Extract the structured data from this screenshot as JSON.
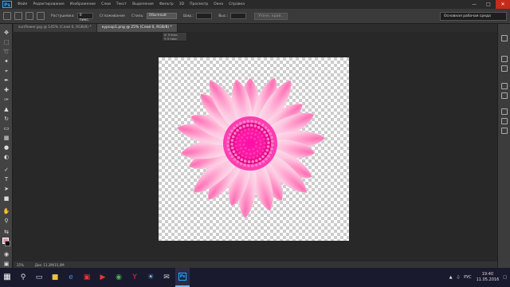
{
  "app": {
    "logo": "Ps"
  },
  "menu": [
    "Файл",
    "Редактирование",
    "Изображение",
    "Слои",
    "Текст",
    "Выделение",
    "Фильтр",
    "3D",
    "Просмотр",
    "Окно",
    "Справка"
  ],
  "options": {
    "feather_label": "Растушевка:",
    "feather_value": "0 пикс.",
    "antialias_label": "Сглаживание",
    "style_label": "Стиль:",
    "style_value": "Обычный",
    "width_label": "Шир.:",
    "height_label": "Выс.:",
    "refine_button": "Уточн. край...",
    "workspace": "Основная рабочая среда"
  },
  "tabs": [
    {
      "label": "sunflower.jpg @ 145% (Слой 0, RGB/8) *",
      "active": false
    },
    {
      "label": "курсор1.png @ 25% (Слой 0, RGB/8) *",
      "active": true
    }
  ],
  "tooltip": {
    "line1": "X: 0 пикс.",
    "line2": "Y: 0 пикс."
  },
  "status": {
    "zoom": "25%",
    "doc": "Док: 11,3М/15,0М"
  },
  "colors": {
    "foreground": "#f28fb0",
    "background": "#000000",
    "accent": "#31a8ff"
  },
  "taskbar": {
    "icons": [
      "search-icon",
      "task-view-icon",
      "file-explorer-icon",
      "edge-icon",
      "store-icon",
      "media-icon",
      "chrome-icon",
      "yandex-icon",
      "photos-icon",
      "mail-icon",
      "photoshop-icon"
    ],
    "language": "РУС",
    "time": "19:40",
    "date": "11.05.2016"
  }
}
